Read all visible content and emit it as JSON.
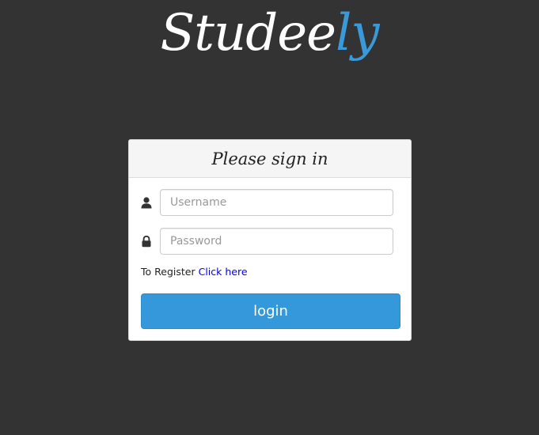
{
  "brand": {
    "name_main": "Studee",
    "name_accent": "ly",
    "accent_color": "#3a9ad9"
  },
  "panel": {
    "title": "Please sign in"
  },
  "form": {
    "username_placeholder": "Username",
    "username_value": "",
    "username_icon": "user-icon",
    "password_placeholder": "Password",
    "password_value": "",
    "password_icon": "lock-icon",
    "register_text": "To Register",
    "register_link": "Click here",
    "login_label": "login",
    "login_color": "#3498db"
  },
  "colors": {
    "background": "#333333",
    "link": "#0000ee"
  }
}
